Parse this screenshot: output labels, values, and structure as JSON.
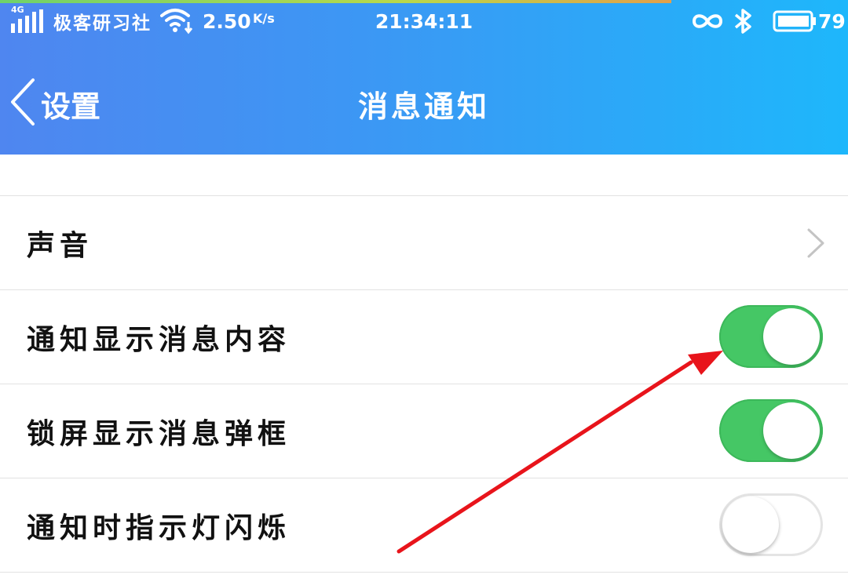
{
  "status_bar": {
    "network": "4G",
    "carrier": "极客研习社",
    "speed": "2.50",
    "speed_unit": "K/s",
    "time": "21:34:11",
    "battery_level": "79"
  },
  "nav": {
    "back_label": "设置",
    "title": "消息通知"
  },
  "settings": [
    {
      "label": "声音",
      "control": "chevron"
    },
    {
      "label": "通知显示消息内容",
      "control": "toggle",
      "state": "on"
    },
    {
      "label": "锁屏显示消息弹框",
      "control": "toggle",
      "state": "on"
    },
    {
      "label": "通知时指示灯闪烁",
      "control": "toggle",
      "state": "off"
    }
  ],
  "colors": {
    "header_start": "#4f86f0",
    "header_end": "#1eb7fb",
    "toggle_on": "#45c765",
    "annotation_arrow": "#e8141b"
  },
  "icons": [
    "signal-icon",
    "wifi-icon",
    "infinity-icon",
    "bluetooth-icon",
    "battery-icon",
    "back-chevron-icon",
    "chevron-right-icon"
  ]
}
